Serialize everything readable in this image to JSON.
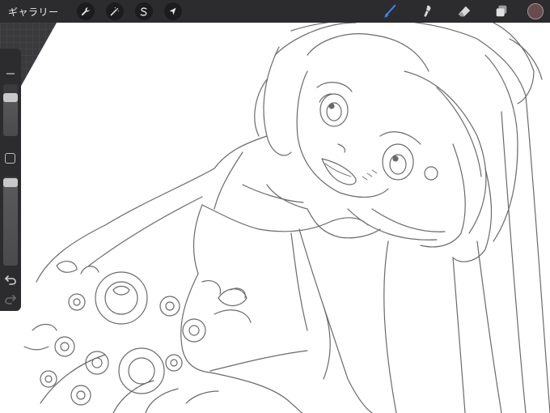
{
  "topbar": {
    "gallery_label": "ギャラリー",
    "actions_icon": "wrench-icon",
    "adjust_icon": "magic-wand-icon",
    "select_icon": "selection-s-icon",
    "transform_icon": "arrow-cursor-icon",
    "brush_icon": "brush-icon",
    "smudge_icon": "smudge-icon",
    "eraser_icon": "eraser-icon",
    "layers_icon": "layers-icon",
    "current_color": "#6b4a4e",
    "active_tool_color": "#3b82f6"
  },
  "sidebar": {
    "brush_size_level": 0.8,
    "brush_opacity_level": 0.98,
    "undo_icon": "undo-icon",
    "redo_icon": "redo-icon"
  },
  "canvas": {
    "content": "sketch-drawing"
  }
}
